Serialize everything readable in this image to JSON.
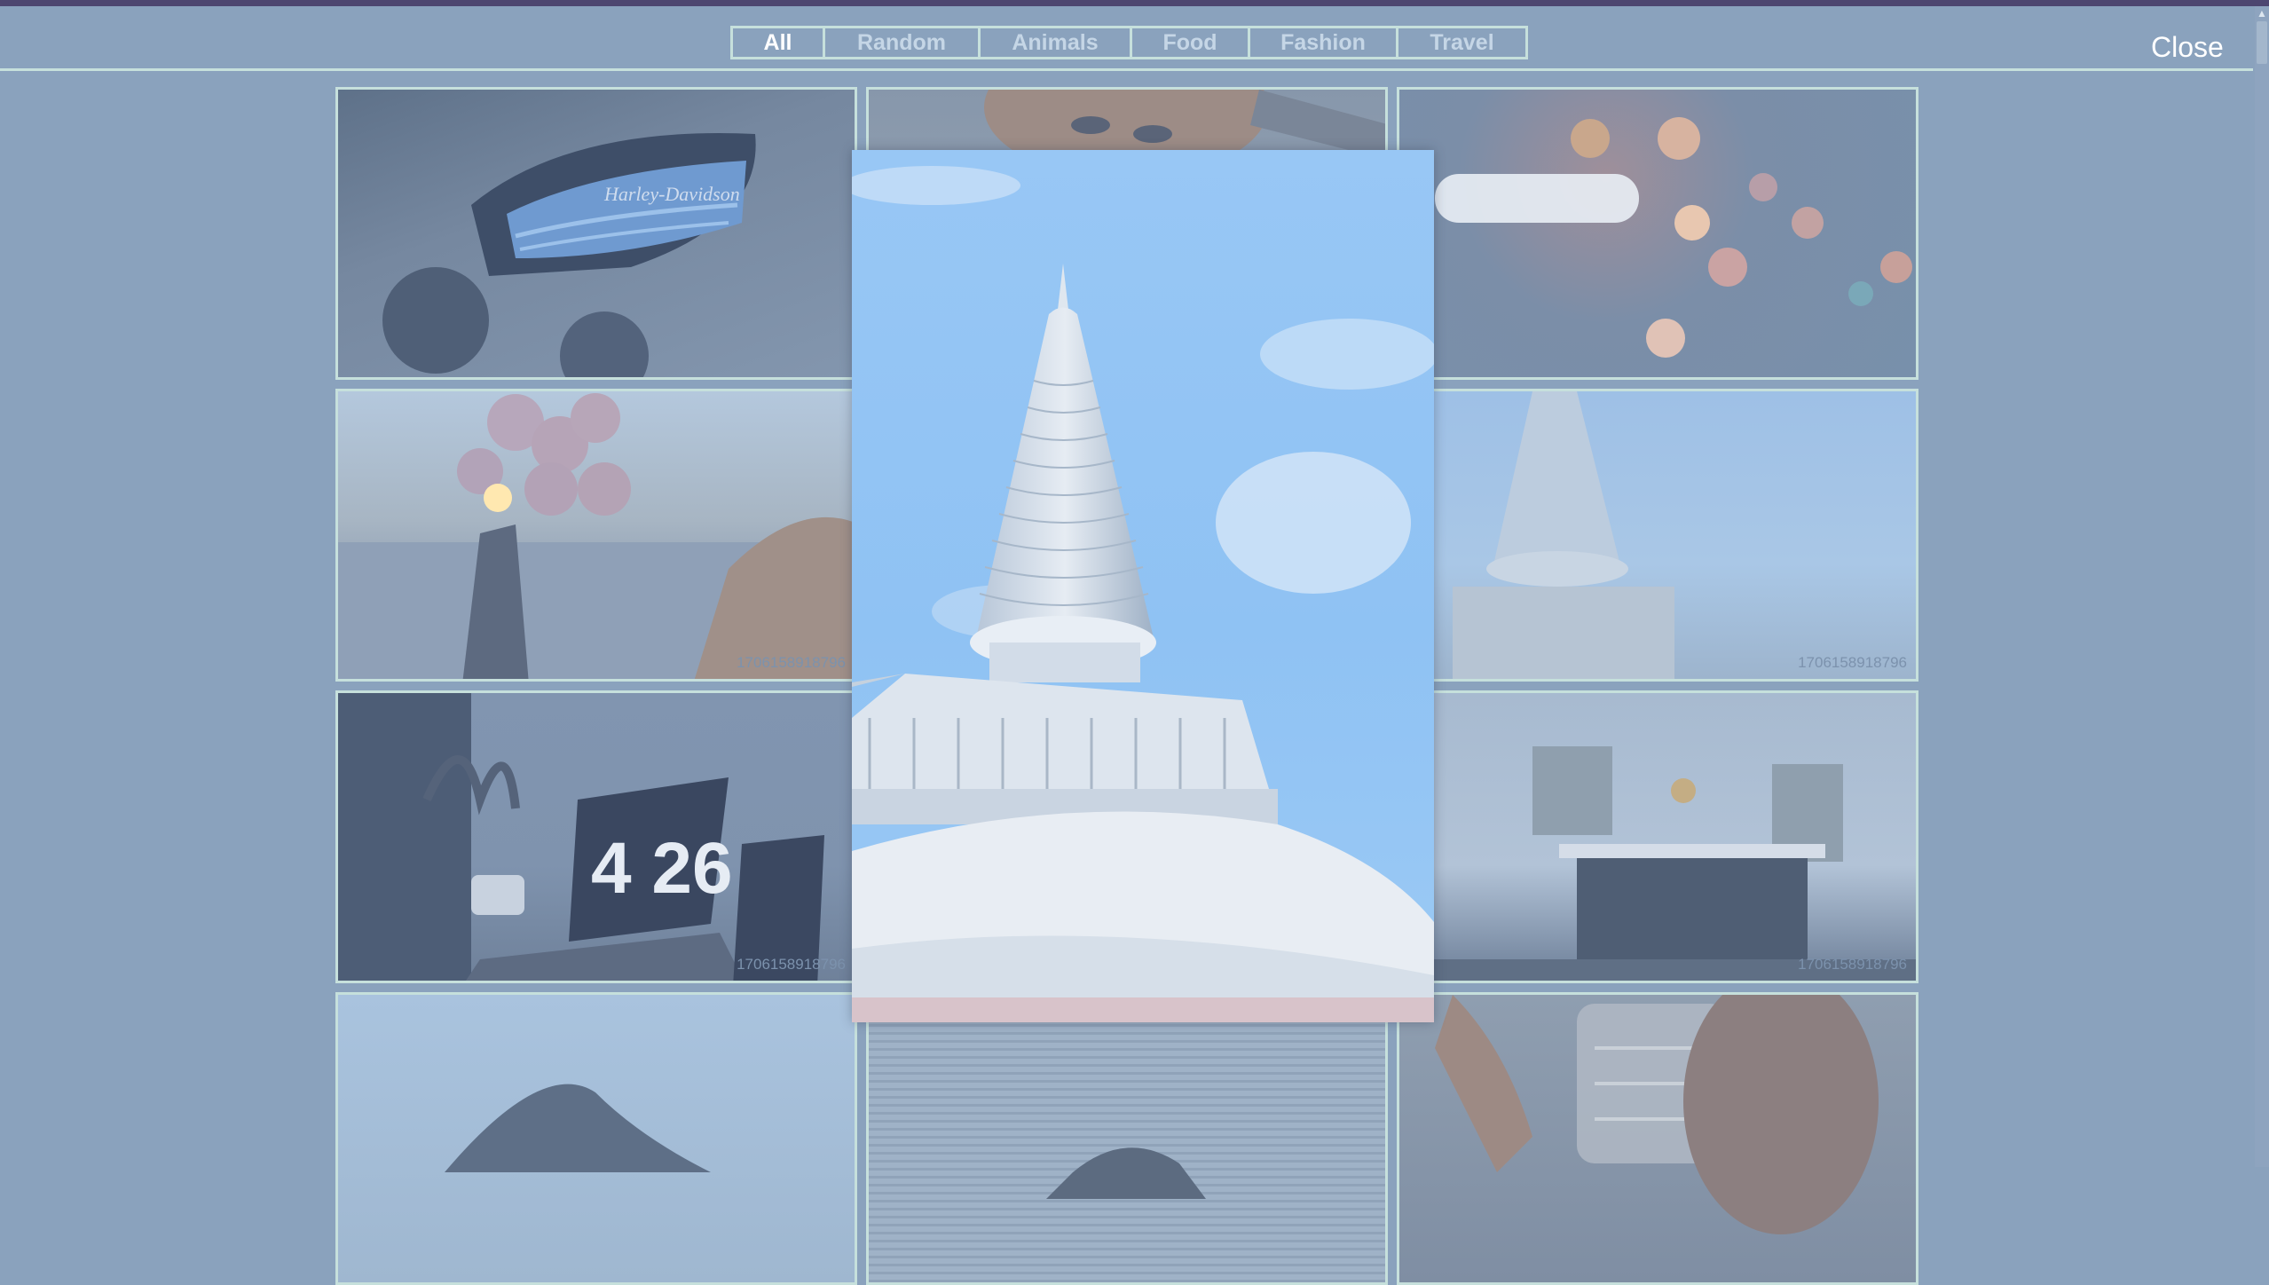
{
  "filters": {
    "tabs": [
      {
        "label": "All",
        "active": true
      },
      {
        "label": "Random",
        "active": false
      },
      {
        "label": "Animals",
        "active": false
      },
      {
        "label": "Food",
        "active": false
      },
      {
        "label": "Fashion",
        "active": false
      },
      {
        "label": "Travel",
        "active": false
      }
    ]
  },
  "close_label": "Close",
  "gallery": {
    "cells": [
      {
        "image": "motorcycle-tank",
        "caption": "",
        "tank_text": "Harley-Davidson"
      },
      {
        "image": "face-portrait",
        "caption": ""
      },
      {
        "image": "bokeh-lights",
        "caption": ""
      },
      {
        "image": "woman-balloons",
        "caption": "1706158918796"
      },
      {
        "image": "stupa-spire",
        "caption": ""
      },
      {
        "image": "stupa-spire",
        "caption": "1706158918796"
      },
      {
        "image": "laptop-clock",
        "caption": "1706158918796",
        "clock_text": "4 26"
      },
      {
        "image": "stupa-spire",
        "caption": ""
      },
      {
        "image": "modern-kitchen",
        "caption": "1706158918796"
      },
      {
        "image": "mountain",
        "caption": ""
      },
      {
        "image": "motorcycle-shutter",
        "caption": ""
      },
      {
        "image": "man-drinking",
        "caption": ""
      }
    ]
  },
  "lightbox": {
    "image": "stupa-spire-sky"
  },
  "colors": {
    "overlay": "#8aa2bd",
    "border": "#c6e0dc",
    "top_strip": "#4d4670",
    "sky": "#92c4f4"
  }
}
